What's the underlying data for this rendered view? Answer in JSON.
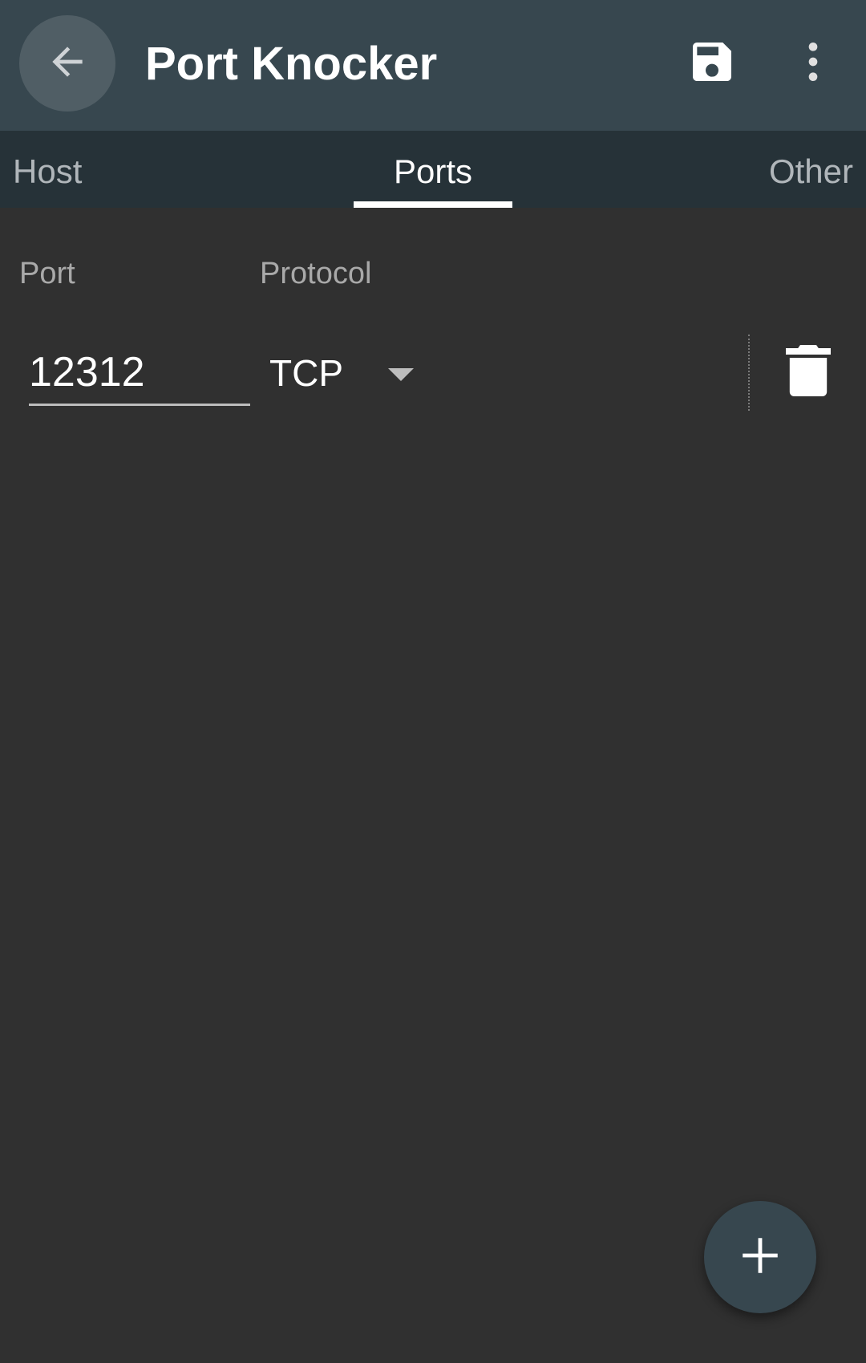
{
  "appbar": {
    "title": "Port Knocker",
    "back_icon": "arrow-back-icon",
    "save_icon": "floppy-disk-icon",
    "more_icon": "more-vert-icon",
    "color": "#37474f"
  },
  "tabs": [
    {
      "label": "Host",
      "active": false
    },
    {
      "label": "Ports",
      "active": true
    },
    {
      "label": "Other",
      "active": false
    }
  ],
  "tab_bar_color": "#263238",
  "ports_section": {
    "port_label": "Port",
    "protocol_label": "Protocol",
    "rows": [
      {
        "port": "12312",
        "protocol": "TCP"
      }
    ],
    "delete_icon": "trash-icon"
  },
  "fab": {
    "icon": "plus-icon"
  },
  "background_color": "#303030"
}
